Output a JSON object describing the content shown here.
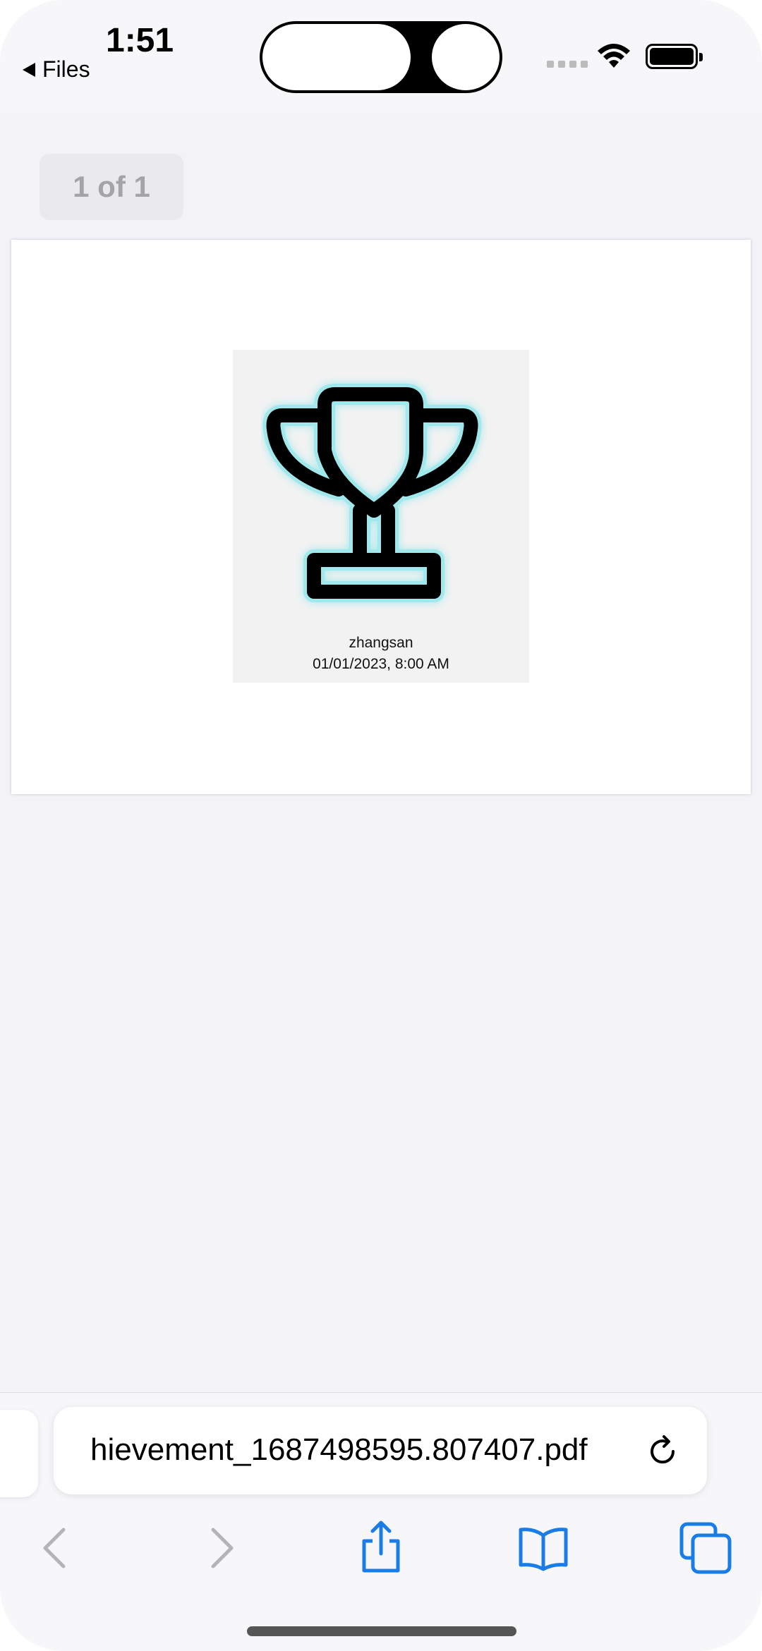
{
  "status_bar": {
    "time": "1:51",
    "back_label": "Files"
  },
  "viewer": {
    "page_indicator": "1 of 1"
  },
  "achievement": {
    "username": "zhangsan",
    "datetime": "01/01/2023, 8:00 AM",
    "icon": "trophy-icon"
  },
  "browser": {
    "address_text": "hievement_1687498595.807407.pdf",
    "nav": {
      "back_icon": "chevron-left-icon",
      "forward_icon": "chevron-right-icon",
      "share_icon": "share-icon",
      "bookmarks_icon": "book-icon",
      "tabs_icon": "tabs-icon"
    }
  },
  "colors": {
    "accent": "#1a7ce6",
    "disabled": "#b3b3b8",
    "trophy_glow": "#5fe0e8"
  }
}
